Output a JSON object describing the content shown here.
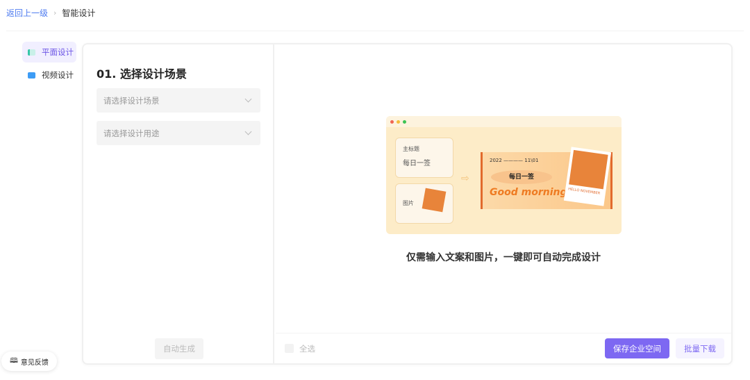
{
  "breadcrumb": {
    "back": "返回上一级",
    "current": "智能设计"
  },
  "sidebar": {
    "items": [
      {
        "label": "平面设计",
        "icon": "image-icon",
        "active": true
      },
      {
        "label": "视频设计",
        "icon": "video-icon",
        "active": false
      }
    ]
  },
  "left_panel": {
    "title": "01. 选择设计场景",
    "scene_placeholder": "请选择设计场景",
    "purpose_placeholder": "请选择设计用途",
    "generate": "自动生成"
  },
  "preview": {
    "title_label": "主标题",
    "title_value": "每日一签",
    "image_label": "图片",
    "date_left": "2022",
    "date_right": "11\\01",
    "poster_title": "每日一签",
    "poster_script": "Good morning",
    "photo_caption": "HELLO NOVEMBER",
    "caption": "仅需输入文案和图片，一键即可自动完成设计"
  },
  "footer": {
    "select_all": "全选",
    "save": "保存企业空间",
    "download": "批量下载"
  },
  "feedback": "意见反馈",
  "colors": {
    "accent": "#7d68f2",
    "link": "#4f7cf0"
  }
}
